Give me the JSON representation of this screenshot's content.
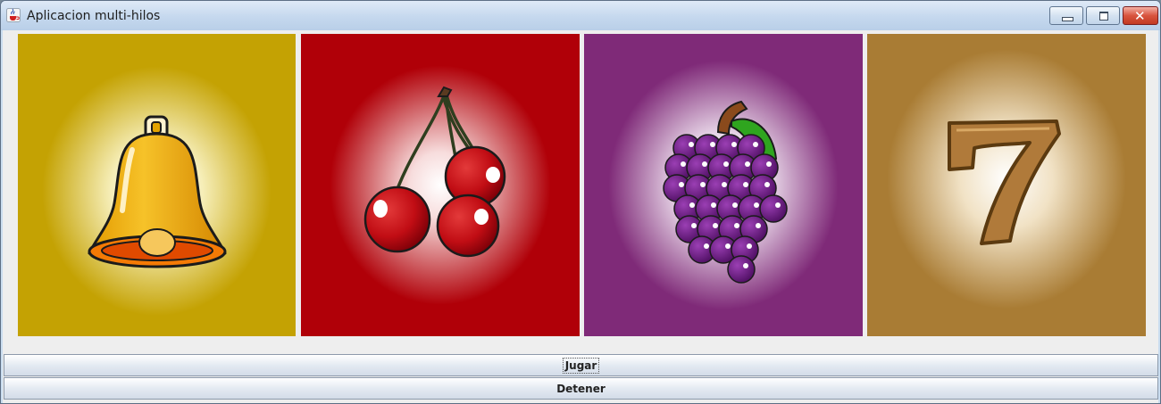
{
  "window": {
    "title": "Aplicacion multi-hilos",
    "app_icon": "java-coffee-cup-icon",
    "controls": [
      "minimize-icon",
      "maximize-icon",
      "close-icon"
    ]
  },
  "reels": [
    {
      "symbol": "bell",
      "background": "#c4a203"
    },
    {
      "symbol": "cherries",
      "background": "#b00008"
    },
    {
      "symbol": "grapes",
      "background": "#7f2a78"
    },
    {
      "symbol": "seven",
      "background": "#a97c34"
    }
  ],
  "buttons": {
    "play_label": "Jugar",
    "stop_label": "Detener"
  }
}
